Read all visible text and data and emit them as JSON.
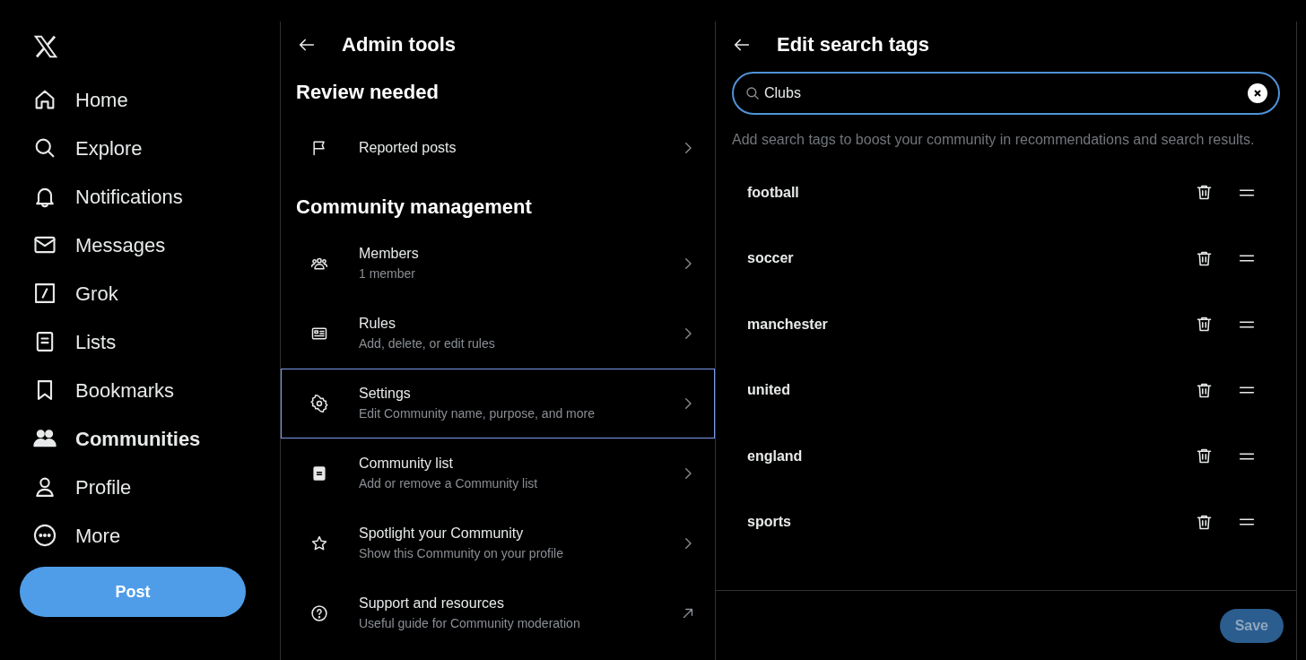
{
  "nav": {
    "items": [
      {
        "label": "Home",
        "selected": false
      },
      {
        "label": "Explore",
        "selected": false
      },
      {
        "label": "Notifications",
        "selected": false
      },
      {
        "label": "Messages",
        "selected": false
      },
      {
        "label": "Grok",
        "selected": false
      },
      {
        "label": "Lists",
        "selected": false
      },
      {
        "label": "Bookmarks",
        "selected": false
      },
      {
        "label": "Communities",
        "selected": true
      },
      {
        "label": "Profile",
        "selected": false
      },
      {
        "label": "More",
        "selected": false
      }
    ],
    "post_button": "Post"
  },
  "admin": {
    "title": "Admin tools",
    "sections": [
      {
        "heading": "Review needed",
        "items": [
          {
            "title": "Reported posts",
            "focused": false
          }
        ]
      },
      {
        "heading": "Community management",
        "items": [
          {
            "title": "Members",
            "subtitle": "1 member",
            "focused": false
          },
          {
            "title": "Rules",
            "subtitle": "Add, delete, or edit rules",
            "focused": false
          },
          {
            "title": "Settings",
            "subtitle": "Edit Community name, purpose, and more",
            "focused": true
          },
          {
            "title": "Community list",
            "subtitle": "Add or remove a Community list",
            "focused": false
          },
          {
            "title": "Spotlight your Community",
            "subtitle": "Show this Community on your profile",
            "focused": false
          },
          {
            "title": "Support and resources",
            "subtitle": "Useful guide for Community moderation",
            "focused": false
          }
        ]
      }
    ]
  },
  "tags_panel": {
    "title": "Edit search tags",
    "search": {
      "value": "Clubs"
    },
    "hint": "Add search tags to boost your community in recommendations and search results.",
    "tags": [
      "football",
      "soccer",
      "manchester",
      "united",
      "england",
      "sports"
    ],
    "save_button": {
      "label": "Save",
      "disabled": true
    }
  }
}
